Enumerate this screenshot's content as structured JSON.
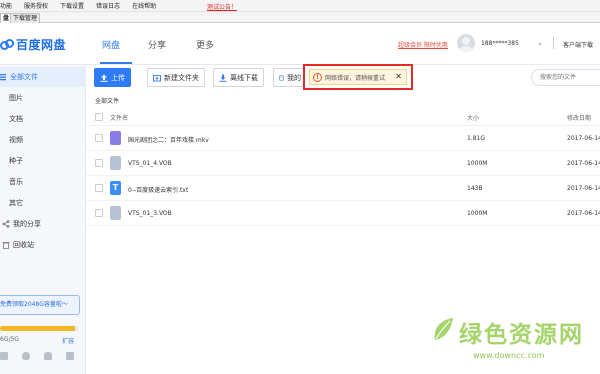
{
  "menubar": {
    "items": [
      "功能",
      "服务授权",
      "下载设置",
      "错误日志",
      "在线帮助"
    ],
    "notice": "测试公告！"
  },
  "tabs": [
    "盘",
    "下载管理"
  ],
  "header": {
    "logo_text": "百度网盘",
    "nav": [
      "网盘",
      "分享",
      "更多"
    ],
    "promo": "超级会员 限时优惠",
    "account": "188*****385",
    "client": "客户端下载"
  },
  "sidebar": {
    "items": [
      "全部文件",
      "图片",
      "文档",
      "视频",
      "种子",
      "音乐",
      "其它",
      "我的分享",
      "回收站"
    ],
    "quota_banner": "免费领取2048G容量啦～",
    "quota_text": "6G/5G",
    "quota_fraction": 0.96,
    "quota_expand": "扩容"
  },
  "toolbar": {
    "upload": "上传",
    "new_folder": "新建文件夹",
    "offline_download": "离线下载",
    "my_devices": "我的",
    "search_placeholder": "搜索您的文件"
  },
  "toast": {
    "message": "网络错误，请稍候重试",
    "close": "✕"
  },
  "list": {
    "breadcrumb": "全部文件",
    "columns": {
      "name": "文件名",
      "size": "大小",
      "date": "修改日期"
    },
    "rows": [
      {
        "name": "国光剧团之二：百年戏楼.mkv",
        "size": "1.81G",
        "date": "2017-06-14",
        "kind": "video"
      },
      {
        "name": "VTS_01_4.VOB",
        "size": "1000M",
        "date": "2017-06-14",
        "kind": "file"
      },
      {
        "name": "0--百度极速云索引.txt",
        "size": "143B",
        "date": "2017-06-14",
        "kind": "txt"
      },
      {
        "name": "VTS_01_3.VOB",
        "size": "1000M",
        "date": "2017-06-14",
        "kind": "file"
      }
    ]
  },
  "watermark": {
    "main": "绿色资源网",
    "url": "www.downcc.com"
  },
  "colors": {
    "accent": "#2f7bf5",
    "error_border": "#e22b2b",
    "quota": "#f2b824",
    "watermark": "#a5d46a"
  }
}
